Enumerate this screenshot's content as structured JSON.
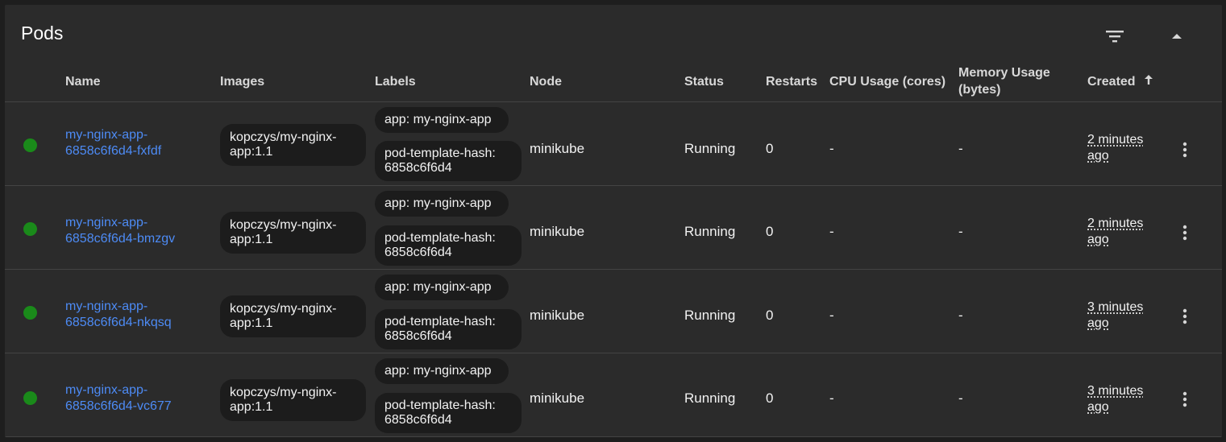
{
  "card": {
    "title": "Pods",
    "filter_icon": "filter-icon",
    "collapse_icon": "chevron-up-icon"
  },
  "columns": {
    "name": "Name",
    "images": "Images",
    "labels": "Labels",
    "node": "Node",
    "status": "Status",
    "restarts": "Restarts",
    "cpu": "CPU Usage (cores)",
    "memory": "Memory Usage (bytes)",
    "created": "Created"
  },
  "colors": {
    "status_running": "#1a8a1a",
    "link": "#4d8bf5"
  },
  "rows": [
    {
      "name": "my-nginx-app-6858c6f6d4-fxfdf",
      "image": "kopczys/my-nginx-app:1.1",
      "label_app": "app: my-nginx-app",
      "label_hash": "pod-template-hash: 6858c6f6d4",
      "node": "minikube",
      "status": "Running",
      "restarts": "0",
      "cpu": "-",
      "memory": "-",
      "created": "2 minutes ago"
    },
    {
      "name": "my-nginx-app-6858c6f6d4-bmzgv",
      "image": "kopczys/my-nginx-app:1.1",
      "label_app": "app: my-nginx-app",
      "label_hash": "pod-template-hash: 6858c6f6d4",
      "node": "minikube",
      "status": "Running",
      "restarts": "0",
      "cpu": "-",
      "memory": "-",
      "created": "2 minutes ago"
    },
    {
      "name": "my-nginx-app-6858c6f6d4-nkqsq",
      "image": "kopczys/my-nginx-app:1.1",
      "label_app": "app: my-nginx-app",
      "label_hash": "pod-template-hash: 6858c6f6d4",
      "node": "minikube",
      "status": "Running",
      "restarts": "0",
      "cpu": "-",
      "memory": "-",
      "created": "3 minutes ago"
    },
    {
      "name": "my-nginx-app-6858c6f6d4-vc677",
      "image": "kopczys/my-nginx-app:1.1",
      "label_app": "app: my-nginx-app",
      "label_hash": "pod-template-hash: 6858c6f6d4",
      "node": "minikube",
      "status": "Running",
      "restarts": "0",
      "cpu": "-",
      "memory": "-",
      "created": "3 minutes ago"
    }
  ]
}
